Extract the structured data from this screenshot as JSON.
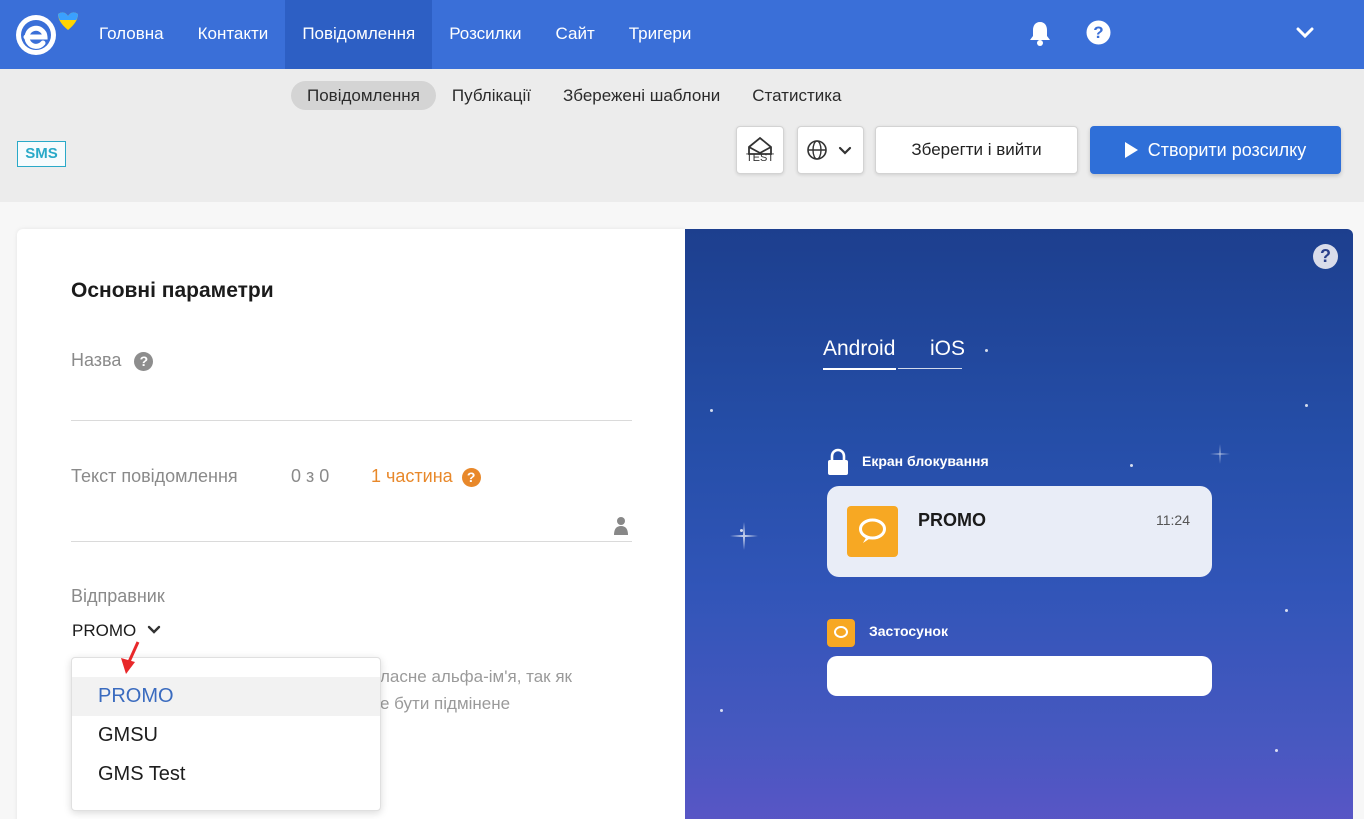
{
  "nav": {
    "items": [
      "Головна",
      "Контакти",
      "Повідомлення",
      "Розсилки",
      "Сайт",
      "Тригери"
    ],
    "active_index": 2
  },
  "subnav": {
    "items": [
      "Повідомлення",
      "Публікації",
      "Збережені шаблони",
      "Статистика"
    ],
    "active_index": 0
  },
  "channel_badge": "SMS",
  "toolbar": {
    "test_label": "TEST",
    "save_label": "Зберегти і вийти",
    "create_label": "Створити розсилку"
  },
  "form": {
    "section_title": "Основні параметри",
    "name_label": "Назва",
    "text_label": "Текст повідомлення",
    "counter": "0 з 0",
    "parts": "1 частина",
    "sender_label": "Відправник",
    "sender_value": "PROMO",
    "hint_line1": "ласне альфа-ім'я, так як",
    "hint_line2": "е бути підмінене"
  },
  "dropdown": {
    "options": [
      "PROMO",
      "GMSU",
      "GMS Test"
    ],
    "selected_index": 0
  },
  "preview": {
    "tabs": [
      "Android",
      "iOS"
    ],
    "active_tab": 0,
    "lock_screen_label": "Екран блокування",
    "notification_title": "PROMO",
    "notification_time": "11:24",
    "app_label": "Застосунок",
    "help": "?"
  },
  "colors": {
    "brand_blue": "#3a6fd8",
    "accent_orange": "#e8882a",
    "sms_badge": "#29a9c8"
  }
}
